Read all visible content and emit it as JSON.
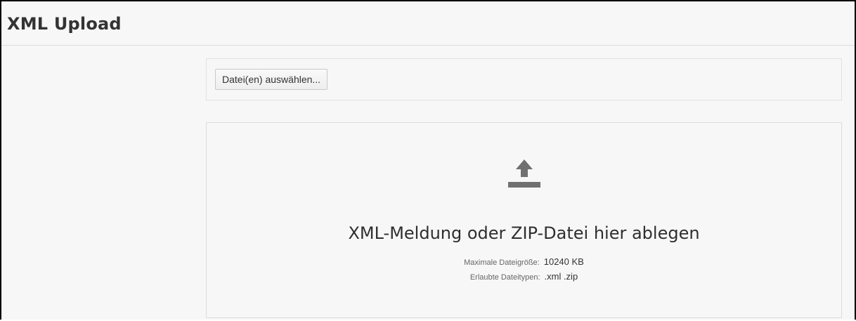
{
  "header": {
    "title": "XML Upload"
  },
  "select": {
    "button_label": "Datei(en) auswählen..."
  },
  "dropzone": {
    "icon": "upload-icon",
    "text": "XML-Meldung oder ZIP-Datei hier ablegen",
    "max_size_label": "Maximale Dateigröße:",
    "max_size_value": "10240 KB",
    "types_label": "Erlaubte Dateitypen:",
    "types_value": ".xml .zip"
  },
  "colors": {
    "icon": "#707070",
    "border": "#dcdcdc",
    "background": "#f7f7f7"
  }
}
